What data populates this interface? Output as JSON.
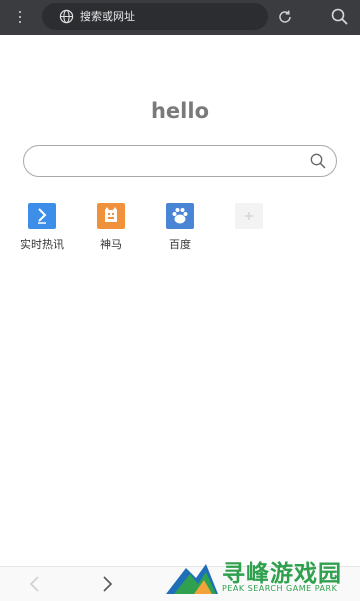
{
  "toolbar": {
    "url_placeholder": "搜索或网址"
  },
  "home": {
    "greeting": "hello",
    "search_placeholder": ""
  },
  "shortcuts": [
    {
      "label": "实时热讯",
      "icon": "realtime-news-icon",
      "color": "#3d8ee8"
    },
    {
      "label": "神马",
      "icon": "shenma-icon",
      "color": "#f0923c"
    },
    {
      "label": "百度",
      "icon": "baidu-paw-icon",
      "color": "#4a84d4"
    },
    {
      "label": "",
      "icon": "add-shortcut-icon",
      "color": "#f3f3f3"
    }
  ],
  "watermark": {
    "title": "寻峰游戏园",
    "subtitle": "PEAK SEARCH GAME PARK"
  },
  "colors": {
    "topbar": "#3a3c40",
    "accent_green": "#2fa14e"
  }
}
